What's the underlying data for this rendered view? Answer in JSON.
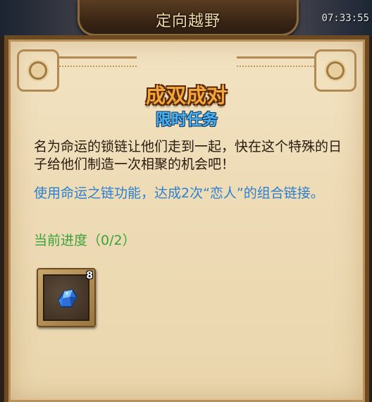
{
  "header": {
    "title": "定向越野",
    "timer": "07:33:55"
  },
  "panel": {
    "main_title": "成双成对",
    "sub_title": "限时任务",
    "description": "名为命运的锁链让他们走到一起，快在这个特殊的日子给他们制造一次相聚的机会吧！",
    "task": "使用命运之链功能，达成2次“恋人”的组合链接。",
    "progress_label": "当前进度",
    "progress_value": "（0/2）",
    "reward": {
      "icon": "blue-crystal-icon",
      "count": "8"
    }
  },
  "colors": {
    "title_orange": "#f3a63a",
    "subtitle_blue": "#4ab3f0",
    "task_blue": "#2d7fd0",
    "progress_green": "#3aa23a",
    "parchment": "#f0ddb8"
  }
}
